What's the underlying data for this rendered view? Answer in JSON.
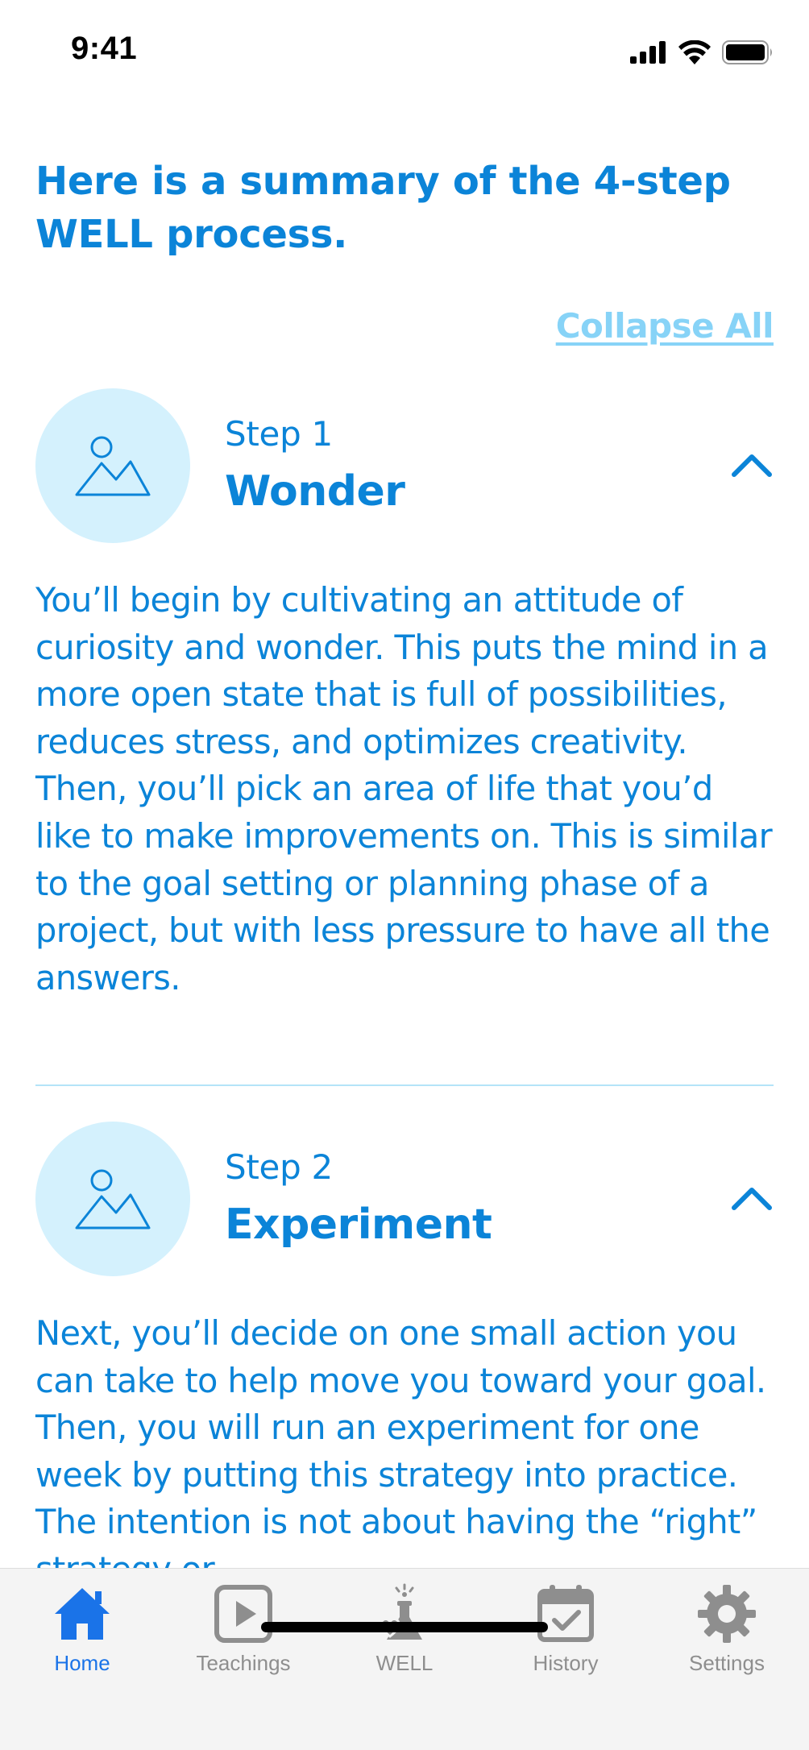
{
  "status_bar": {
    "time": "9:41"
  },
  "header": {
    "title": "Here is a summary of the 4-step WELL process."
  },
  "actions": {
    "collapse_all": "Collapse All"
  },
  "steps": [
    {
      "number": "Step 1",
      "name": "Wonder",
      "body": "You’ll begin by cultivating an attitude of curiosity and wonder. This puts the mind in a more open state that is full of possibilities, reduces stress, and optimizes creativity. Then, you’ll pick an area of life that you’d like to make improvements on. This is similar to the goal setting or planning phase of a project, but with less pressure to have all the answers."
    },
    {
      "number": "Step 2",
      "name": "Experiment",
      "body": "Next, you’ll decide on one small action you can take to help move you toward your goal. Then, you will run an experiment for one week by putting this strategy into practice. The intention is not about having the “right” strategy or"
    }
  ],
  "tabs": [
    {
      "label": "Home",
      "icon": "home-icon",
      "active": true
    },
    {
      "label": "Teachings",
      "icon": "play-icon",
      "active": false
    },
    {
      "label": "WELL",
      "icon": "flask-icon",
      "active": false
    },
    {
      "label": "History",
      "icon": "calendar-check-icon",
      "active": false
    },
    {
      "label": "Settings",
      "icon": "gear-icon",
      "active": false
    }
  ],
  "colors": {
    "accent": "#0b84d8",
    "link": "#87d3f7",
    "thumb_bg": "#d4f1fd",
    "tab_active": "#1a73e8",
    "tab_inactive": "#8e8e8e"
  }
}
